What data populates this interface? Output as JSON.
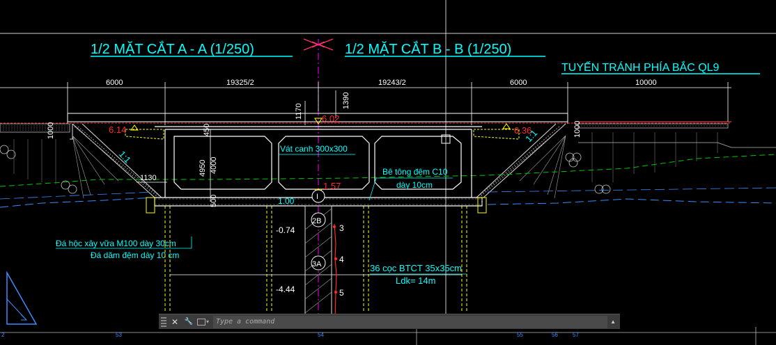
{
  "titles": {
    "section_a": "1/2 MẶT CẮT A - A (1/250)",
    "section_b": "1/2 MẶT CẮT B - B (1/250)",
    "route": "TUYẾN TRÁNH PHÍA BẮC QL9"
  },
  "dimensions": {
    "left_6000": "6000",
    "left_span": "19325/2",
    "right_span": "19243/2",
    "right_6000": "6000",
    "far_right": "10000",
    "v_1390": "1390",
    "v_1170": "1170",
    "v_1000_left": "1000",
    "v_1000_right": "1000",
    "v_450": "450",
    "v_4950": "4950",
    "v_4000": "4000",
    "v_500": "500",
    "h_1130": "1130"
  },
  "elevations": {
    "top": "6.02",
    "left": "6.14",
    "right": "6.36",
    "bottom": "1.57",
    "base": "1.00",
    "pile_a": "-0.74",
    "pile_b": "-4.44"
  },
  "slopes": {
    "left": "1:1",
    "right": "1:1"
  },
  "annotations": {
    "fillet": "Vát canh 300x300",
    "concrete_1": "Bê tông đệm C10",
    "concrete_2": "dày 10cm",
    "stone_1": "Đá hộc xây vữa M100 dày 30cm",
    "stone_2": "Đá dăm đệm dày 10 cm",
    "piles_1": "36 cọc BTCT 35x35cm",
    "piles_2": "Ldk= 14m"
  },
  "layers": {
    "l2b": "2B",
    "l3a": "3A",
    "n3": "3",
    "n4": "4",
    "n5": "5",
    "n4b": "4",
    "center_mark": "I"
  },
  "bottom_ruler": {
    "r1": "2",
    "r2": "53",
    "r3": "54",
    "r4": "55",
    "r5": "56",
    "r6": "57"
  },
  "command_line": {
    "placeholder": "Type a command",
    "close_glyph": "✕",
    "wrench_glyph": "🔧",
    "up_glyph": "▲"
  },
  "colors": {
    "cyan": "#00ffff",
    "white": "#ffffff",
    "red": "#ff2a2a",
    "yellow": "#ffff00",
    "green": "#00c800",
    "magenta": "#ff00ff",
    "blue": "#3a8cff"
  }
}
